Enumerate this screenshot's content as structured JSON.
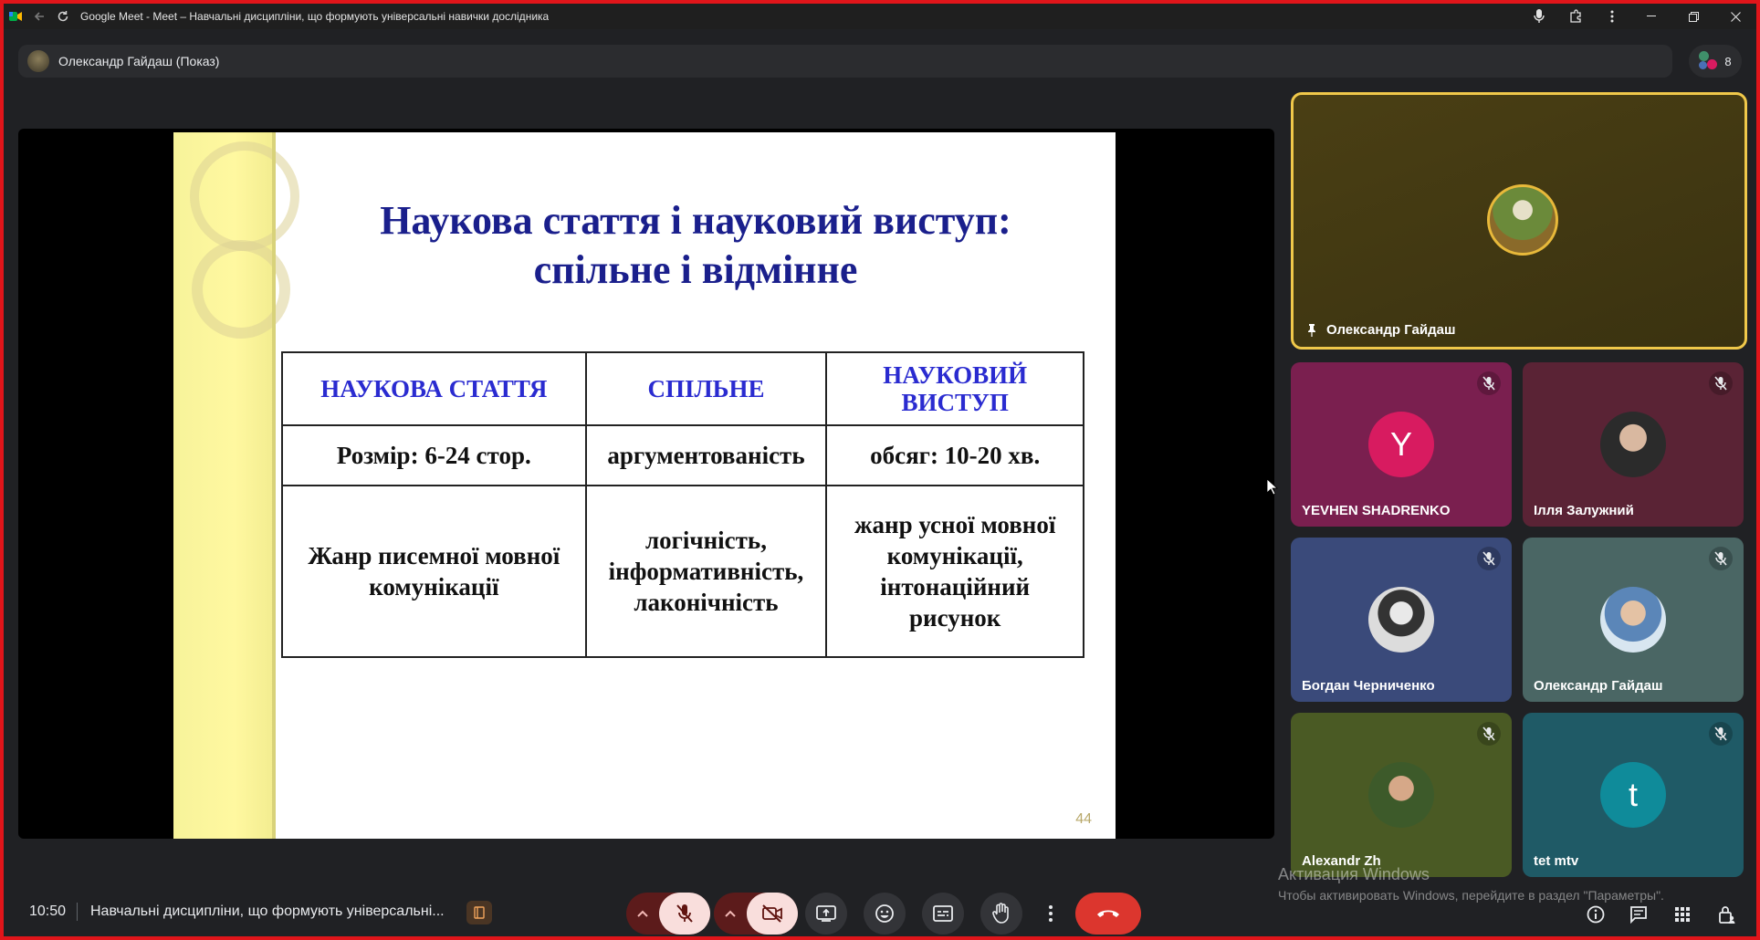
{
  "browser": {
    "window_title": "Google Meet - Meet – Навчальні дисципліни, що формують універсальні навички дослідника"
  },
  "presenter_bar": {
    "label": "Олександр Гайдаш (Показ)"
  },
  "people": {
    "count": "8"
  },
  "slide": {
    "title_line1": "Наукова стаття і науковий виступ:",
    "title_line2": "спільне і відмінне",
    "table": {
      "headers": [
        "НАУКОВА СТАТТЯ",
        "СПІЛЬНЕ",
        "НАУКОВИЙ ВИСТУП"
      ],
      "rows": [
        [
          "Розмір: 6-24 стор.",
          "аргументованість",
          "обсяг: 10-20 хв."
        ],
        [
          "Жанр писемної мовної комунікації",
          "логічність, інформативність, лаконічність",
          "жанр усної мовної комунікації, інтонаційний рисунок"
        ]
      ]
    },
    "page_number": "44"
  },
  "participants": {
    "pinned": {
      "name": "Олександр Гайдаш",
      "pin_icon": "pin-icon"
    },
    "tiles": [
      {
        "name": "YEVHEN SHADRENKO",
        "initial": "Y",
        "muted": true,
        "bg": "#7a1f4f",
        "avatar_color": "#d81b60"
      },
      {
        "name": "Ілля Залужний",
        "initial": "",
        "muted": true,
        "bg": "#5a2335",
        "avatar_color": "#2b2b2b"
      },
      {
        "name": "Богдан Черниченко",
        "initial": "",
        "muted": true,
        "bg": "#3a4a7a",
        "avatar_color": "#cfcfcf"
      },
      {
        "name": "Олександр Гайдаш",
        "initial": "",
        "muted": true,
        "bg": "#4a6664",
        "avatar_color": "#6aa0c8"
      },
      {
        "name": "Alexandr Zh",
        "initial": "",
        "muted": true,
        "bg": "#4a5a24",
        "avatar_color": "#5b6b3a"
      },
      {
        "name": "tet mtv",
        "initial": "t",
        "muted": true,
        "bg": "#1f5a66",
        "avatar_color": "#0f8b9a"
      }
    ]
  },
  "bottom_bar": {
    "time": "10:50",
    "meeting_title": "Навчальні дисципліни, що формують універсальні..."
  },
  "windows_activation": {
    "line1": "Активация Windows",
    "line2": "Чтобы активировать Windows, перейдите в раздел \"Параметры\"."
  },
  "colors": {
    "accent_pinned_border": "#f0c84a",
    "leave_red": "#dc362e",
    "slide_title_blue": "#1a1f8c",
    "slide_header_blue": "#2a2bd0"
  }
}
